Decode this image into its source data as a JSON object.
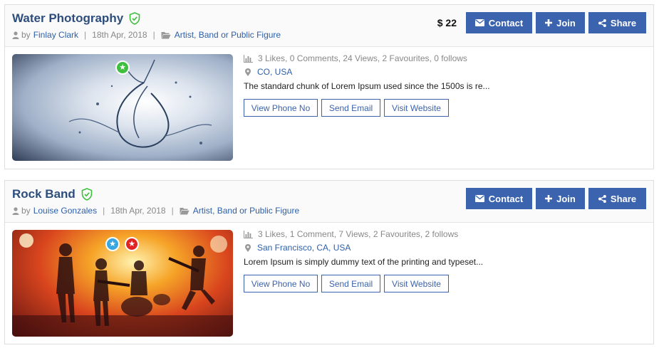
{
  "listings": [
    {
      "title": "Water Photography",
      "by_label": "by",
      "author": "Finlay Clark",
      "date": "18th Apr, 2018",
      "category": "Artist, Band or Public Figure",
      "price": "$ 22",
      "contact_label": "Contact",
      "join_label": "Join",
      "share_label": "Share",
      "stats": "3 Likes, 0 Comments, 24 Views, 2 Favourites, 0 follows",
      "location": "CO, USA",
      "description": "The standard chunk of Lorem Ipsum used since the 1500s is re...",
      "phone_label": "View Phone No",
      "email_label": "Send Email",
      "website_label": "Visit Website",
      "image": "water-splash-photo",
      "badges": [
        {
          "icon": "star-icon",
          "color": "#3fbf3f"
        }
      ]
    },
    {
      "title": "Rock Band",
      "by_label": "by",
      "author": "Louise Gonzales",
      "date": "18th Apr, 2018",
      "category": "Artist, Band or Public Figure",
      "price": "",
      "contact_label": "Contact",
      "join_label": "Join",
      "share_label": "Share",
      "stats": "3 Likes, 1 Comment, 7 Views, 2 Favourites, 2 follows",
      "location": "San Francisco, CA, USA",
      "description": "Lorem Ipsum is simply dummy text of the printing and typeset...",
      "phone_label": "View Phone No",
      "email_label": "Send Email",
      "website_label": "Visit Website",
      "image": "rock-band-concert-photo",
      "badges": [
        {
          "icon": "star-icon",
          "color": "#3aa6e0"
        },
        {
          "icon": "star-icon",
          "color": "#e02424"
        }
      ]
    }
  ],
  "colors": {
    "primary": "#3c63ad",
    "title": "#2d4d7c",
    "verified": "#3fbf3f",
    "link": "#2d5fa8"
  }
}
